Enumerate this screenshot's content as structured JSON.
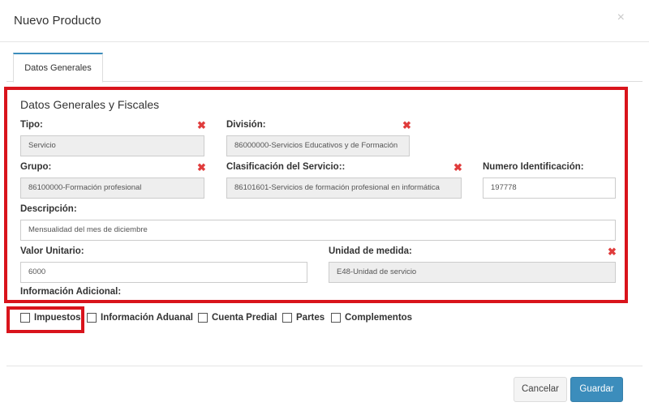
{
  "modal": {
    "title": "Nuevo Producto",
    "close_glyph": "×"
  },
  "tabs": [
    {
      "label": "Datos Generales",
      "active": true
    }
  ],
  "section": {
    "title": "Datos Generales y Fiscales"
  },
  "fields": {
    "tipo": {
      "label": "Tipo:",
      "value": "Servicio",
      "required": true
    },
    "division": {
      "label": "División:",
      "value": "86000000-Servicios Educativos y de Formación",
      "required": true
    },
    "grupo": {
      "label": "Grupo:",
      "value": "86100000-Formación profesional",
      "required": true
    },
    "clasificacion": {
      "label": "Clasificación del Servicio::",
      "value": "86101601-Servicios de formación profesional en informática",
      "required": true
    },
    "numero_id": {
      "label": "Numero Identificación:",
      "value": "197778"
    },
    "descripcion": {
      "label": "Descripción:",
      "value": "Mensualidad del mes de diciembre"
    },
    "valor_unitario": {
      "label": "Valor Unitario:",
      "value": "6000"
    },
    "unidad_medida": {
      "label": "Unidad de medida:",
      "value": "E48-Unidad de servicio",
      "required": true
    }
  },
  "info_adicional": {
    "label": "Información Adicional:"
  },
  "required_glyph": "✖",
  "checkboxes": [
    {
      "label": "Impuestos",
      "checked": false
    },
    {
      "label": "Información Aduanal",
      "checked": false
    },
    {
      "label": "Cuenta Predial",
      "checked": false
    },
    {
      "label": "Partes",
      "checked": false
    },
    {
      "label": "Complementos",
      "checked": false
    }
  ],
  "buttons": {
    "cancel": "Cancelar",
    "save": "Guardar"
  },
  "colors": {
    "accent": "#3c8dbc",
    "required_icon": "#e03c3c",
    "highlight_border": "#d9141c",
    "readonly_bg": "#eeeeee"
  }
}
